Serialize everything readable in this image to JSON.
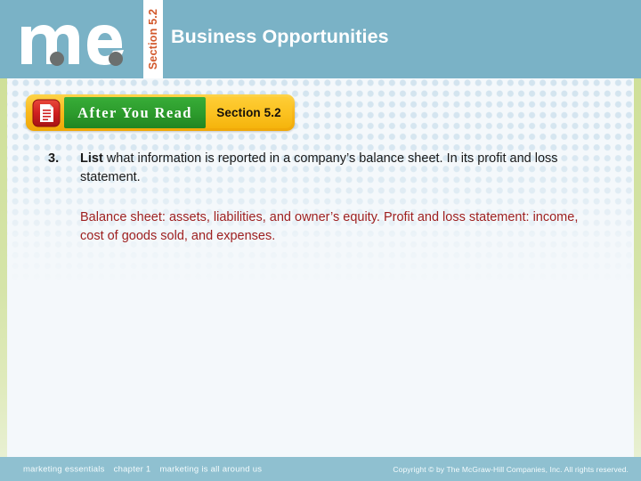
{
  "header": {
    "logo_alt": "me",
    "section_tab_label": "Section 5.2",
    "title": "Business Opportunities",
    "background_color": "#7ab2c6",
    "tab_text_color": "#d2572a"
  },
  "banner": {
    "icon_name": "document-lines-icon",
    "green_label": "After You Read",
    "yellow_label": "Section 5.2",
    "green_color": "#2c9a2c",
    "yellow_color": "#fbc11f",
    "frame_color": "#f9b91d"
  },
  "content": {
    "question_number": "3.",
    "question_lead": "List",
    "question_rest": " what information is reported in a company’s balance sheet. In its profit and loss statement.",
    "answer": "Balance sheet: assets, liabilities, and owner’s equity. Profit and loss statement: income, cost of goods sold, and expenses.",
    "answer_color": "#9e2020"
  },
  "footer": {
    "left_parts": [
      "marketing essentials",
      "chapter 1",
      "marketing is all around us"
    ],
    "right": "Copyright © by The McGraw-Hill Companies, Inc. All rights reserved.",
    "background_color": "#8fc0d0"
  },
  "decor": {
    "edge_strip_color": "#d5e4a8",
    "dot_color": "#d3e4ef"
  }
}
